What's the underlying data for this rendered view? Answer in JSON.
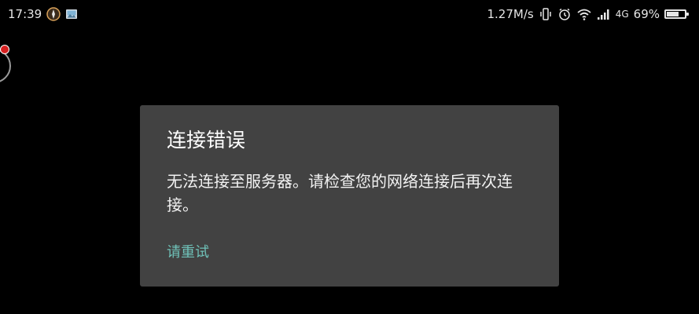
{
  "status_bar": {
    "time": "17:39",
    "network_speed": "1.27M/s",
    "network_type": "4G",
    "battery_percent": "69%",
    "battery_level": 0.69,
    "icons": [
      "compass-icon",
      "image-notification-icon",
      "vibrate-icon",
      "alarm-icon",
      "wifi-icon",
      "signal-icon",
      "battery-icon"
    ]
  },
  "dialog": {
    "title": "连接错误",
    "message": "无法连接至服务器。请检查您的网络连接后再次连接。",
    "action_label": "请重试"
  },
  "colors": {
    "background": "#000000",
    "dialog_background": "#424242",
    "action_accent": "#6fc1b8",
    "widget_dot": "#d62020"
  }
}
